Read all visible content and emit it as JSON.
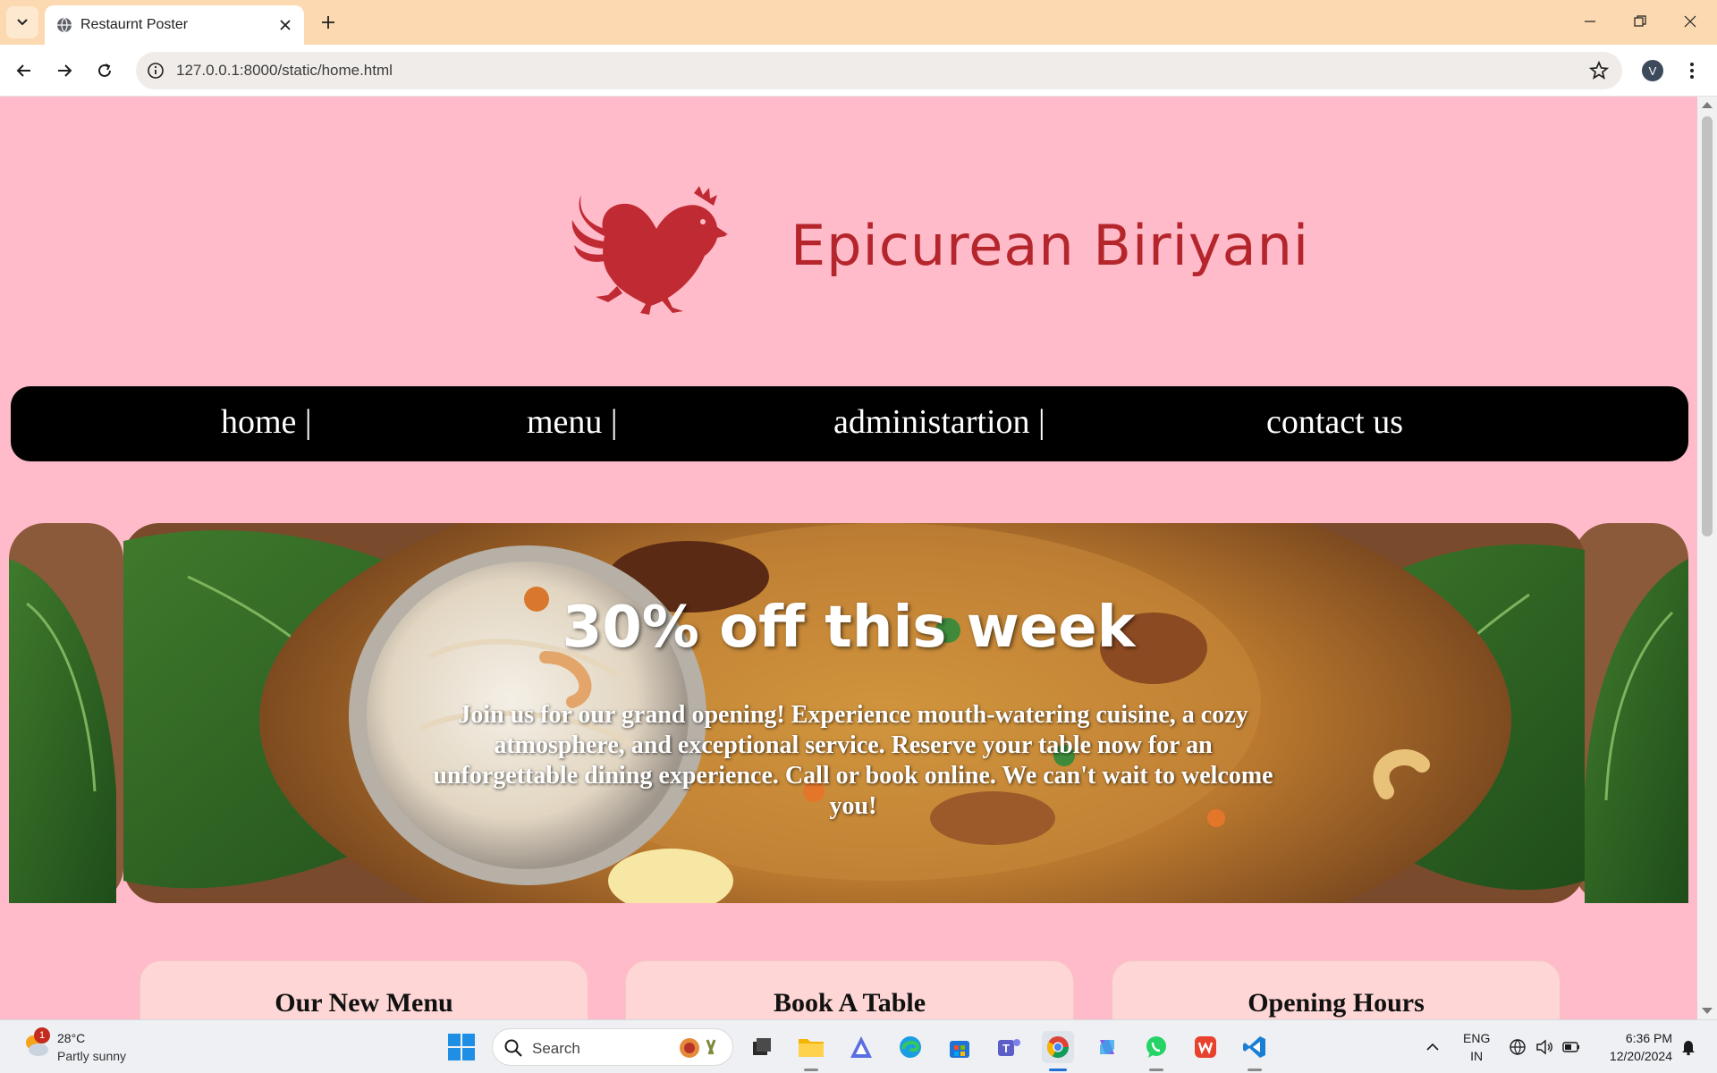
{
  "browser": {
    "tab_title": "Restaurnt Poster",
    "url": "127.0.0.1:8000/static/home.html",
    "profile_initial": "V"
  },
  "site": {
    "brand": "Epicurean Biriyani",
    "nav": {
      "home": "home |",
      "menu": "menu |",
      "admin": "administartion |",
      "contact": "contact us"
    },
    "banner": {
      "heading": "30% off this week",
      "text": "Join us for our grand opening! Experience mouth-watering cuisine, a cozy atmosphere, and exceptional service. Reserve your table now for an unforgettable dining experience. Call or book online. We can't wait to welcome you!"
    },
    "cards": {
      "menu": "Our New Menu",
      "book": "Book A Table",
      "hours": "Opening Hours"
    },
    "colors": {
      "background": "#ffbbc9",
      "brand": "#b5262c",
      "nav_bg": "#000000",
      "card_bg": "#fdd6d5"
    }
  },
  "taskbar": {
    "weather_badge": "1",
    "temperature": "28°C",
    "weather": "Partly sunny",
    "search_placeholder": "Search",
    "lang_top": "ENG",
    "lang_bottom": "IN",
    "time": "6:36 PM",
    "date": "12/20/2024"
  }
}
